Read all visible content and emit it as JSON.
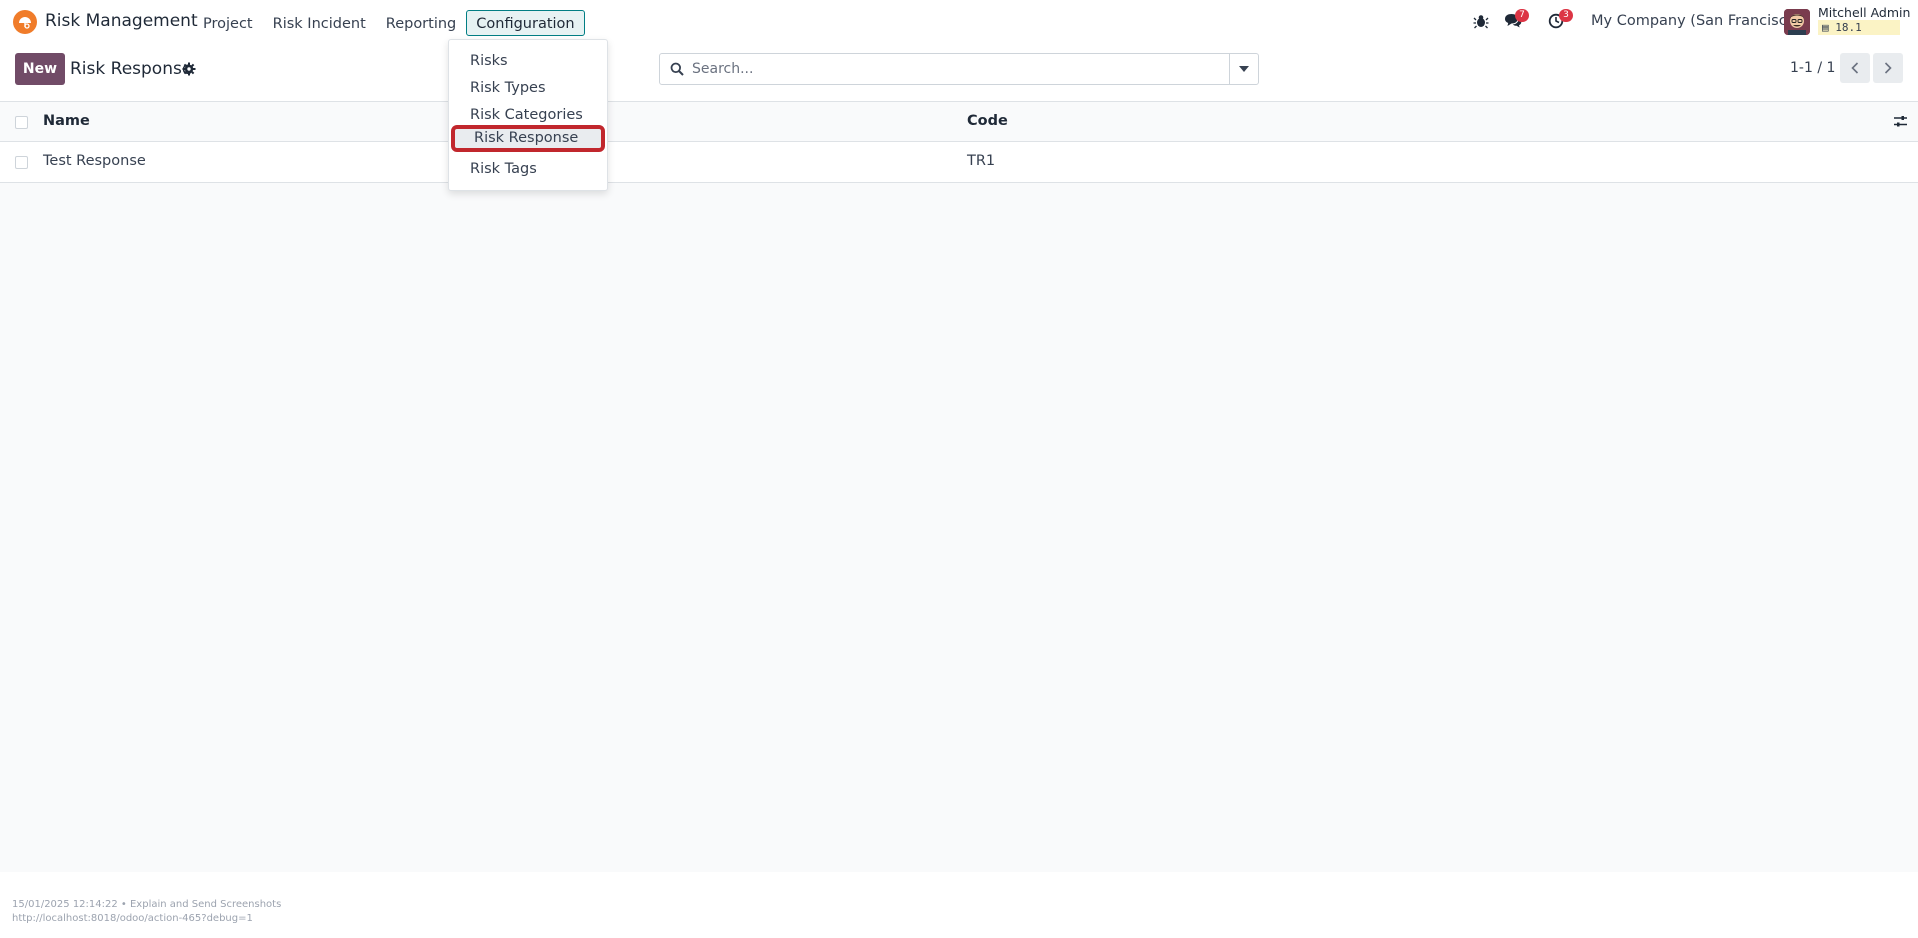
{
  "app": {
    "name": "Risk Management",
    "logo_color": "#f07c2a"
  },
  "nav": {
    "items": [
      {
        "label": "Project"
      },
      {
        "label": "Risk Incident"
      },
      {
        "label": "Reporting"
      },
      {
        "label": "Configuration",
        "active": true
      }
    ]
  },
  "systray": {
    "bug_icon": "bug-icon",
    "messages_count": "7",
    "activities_count": "3",
    "company": "My Company (San Francisco)",
    "user_name": "Mitchell Admin",
    "db_version": "18.1"
  },
  "control_panel": {
    "new_label": "New",
    "title": "Risk Response",
    "search_placeholder": "Search...",
    "pager": "1-1 / 1"
  },
  "dropdown": {
    "items": [
      {
        "label": "Risks"
      },
      {
        "label": "Risk Types"
      },
      {
        "label": "Risk Categories"
      },
      {
        "label": "Risk Response",
        "highlighted": true
      },
      {
        "label": "Risk Tags"
      }
    ]
  },
  "list": {
    "columns": [
      "Name",
      "Code"
    ],
    "rows": [
      {
        "name": "Test Response",
        "code": "TR1"
      }
    ]
  },
  "footer": {
    "line1": "15/01/2025 12:14:22 • Explain and Send Screenshots",
    "line2": "http://localhost:8018/odoo/action-465?debug=1"
  },
  "colors": {
    "primary": "#714b67",
    "accent": "#017e84",
    "highlight_border": "#c1272d",
    "badge": "#dc3545"
  }
}
